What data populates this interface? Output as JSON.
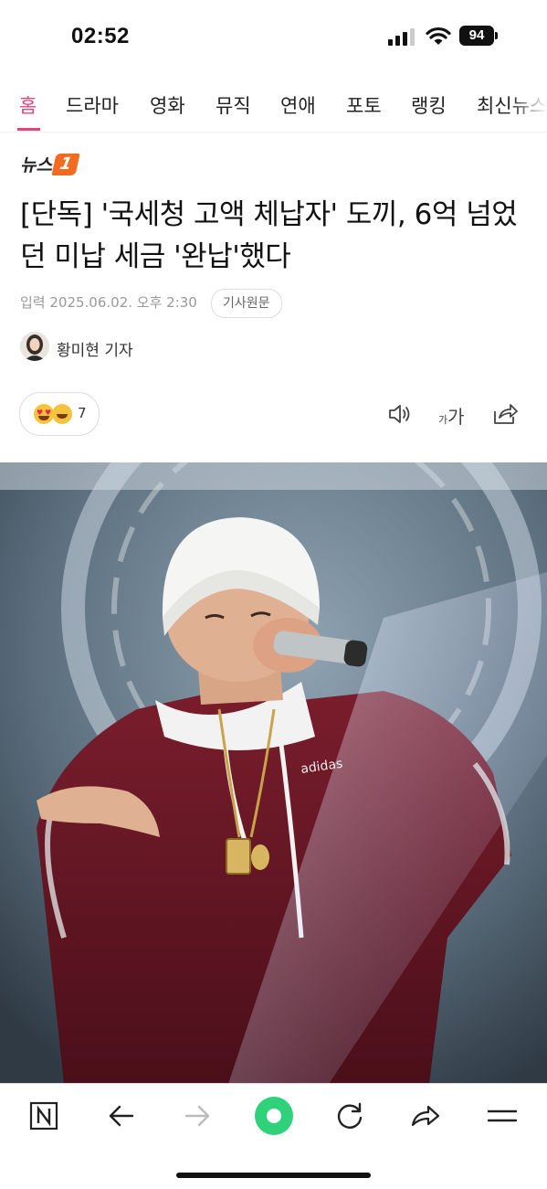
{
  "status_bar": {
    "time": "02:52",
    "battery": "94"
  },
  "tabs": [
    {
      "label": "홈",
      "active": true
    },
    {
      "label": "드라마"
    },
    {
      "label": "영화"
    },
    {
      "label": "뮤직"
    },
    {
      "label": "연애"
    },
    {
      "label": "포토"
    },
    {
      "label": "랭킹"
    },
    {
      "label": "최신뉴스"
    }
  ],
  "publisher": {
    "name": "뉴스",
    "badge": "1",
    "badge_color": "#f26b21"
  },
  "article": {
    "headline": "[단독] '국세청 고액 체납자' 도끼, 6억 넘었던 미납 세금 '완납'했다",
    "date_line": "입력 2025.06.02. 오후 2:30",
    "source_button": "기사원문",
    "author": "황미현 기자"
  },
  "reactions": {
    "count": "7"
  },
  "toolbar": {
    "speaker_icon": "speaker-icon",
    "font_size_small": "가",
    "font_size_big": "가",
    "share_icon": "share-icon"
  },
  "bottom_bar": {
    "items": [
      "naver-home-icon",
      "back-arrow-icon",
      "forward-arrow-icon",
      "green-dot-button",
      "refresh-icon",
      "share-arrow-icon",
      "menu-icon"
    ]
  },
  "colors": {
    "accent": "#e0467c",
    "green": "#03c75a"
  }
}
